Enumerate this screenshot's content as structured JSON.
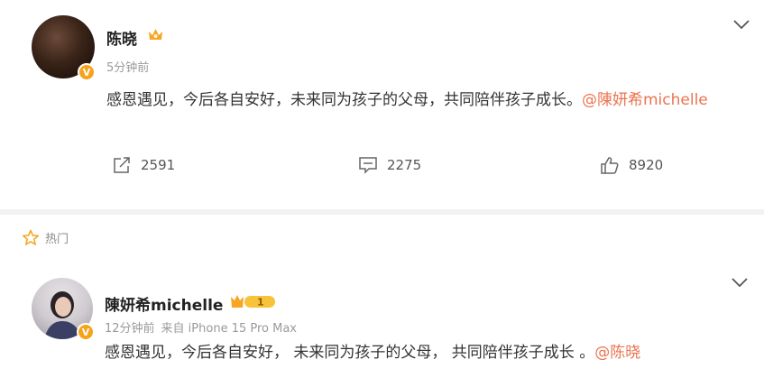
{
  "post": {
    "author": "陈晓",
    "time": "5分钟前",
    "text": "感恩遇见，今后各自安好，未来同为孩子的父母，共同陪伴孩子成长。",
    "mention": "@陳妍希michelle",
    "actions": {
      "repost_count": "2591",
      "comment_count": "2275",
      "like_count": "8920"
    }
  },
  "hot_section": {
    "label": "热门"
  },
  "reply": {
    "author": "陳妍希michelle",
    "time": "12分钟前",
    "source": "来自 iPhone 15 Pro Max",
    "text": "感恩遇见，今后各自安好， 未来同为孩子的父母， 共同陪伴孩子成长 。",
    "mention": "@陈晓",
    "vip_level": "1"
  },
  "colors": {
    "accent": "#eb7350",
    "verified_badge": "#f7a21b",
    "muted_text": "#9a9a9a"
  }
}
